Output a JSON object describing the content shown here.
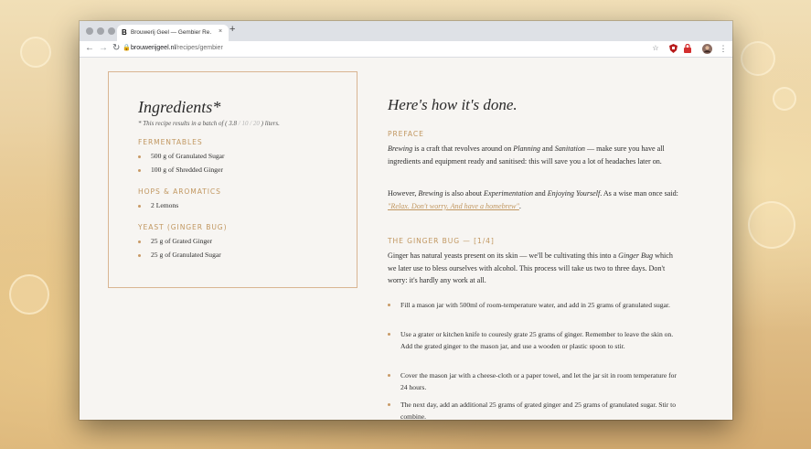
{
  "browser": {
    "tab_favicon": "B",
    "tab_title": "Brouwerij Geel — Gembier Re…",
    "tab_close": "×",
    "new_tab": "+",
    "url_host": "brouwerijgeel.nl",
    "url_path": "/recipes/gembier",
    "icons": [
      "back-icon",
      "forward-icon",
      "reload-icon",
      "lock-icon",
      "star-icon",
      "shield-extension-icon",
      "lock-extension-icon",
      "profile-avatar-icon",
      "menu-icon"
    ]
  },
  "ingredients": {
    "title": "Ingredients*",
    "batch_prefix": "* This recipe results in a batch of (",
    "batch_options": [
      "3.8",
      "10",
      "20"
    ],
    "batch_active": "3.8",
    "batch_suffix": ") liters.",
    "sections": [
      {
        "name": "FERMENTABLES",
        "items": [
          "500 g of Granulated Sugar",
          "100 g of Shredded Ginger"
        ]
      },
      {
        "name": "HOPS & AROMATICS",
        "items": [
          "2 Lemons"
        ]
      },
      {
        "name": "YEAST (GINGER BUG)",
        "items": [
          "25 g of Grated Ginger",
          "25 g of Granulated Sugar"
        ]
      }
    ]
  },
  "howto": {
    "title": "Here's how it's done.",
    "preface_heading": "PREFACE",
    "preface_p1": {
      "t1": "Brewing",
      "t2": " is a craft that revolves around on ",
      "t3": "Planning",
      "t4": " and ",
      "t5": "Sanitation",
      "t6": " — make sure you have all ingredients and equipment ready and sanitised: this will save you a lot of headaches later on."
    },
    "preface_p2": {
      "t1": "However, ",
      "t2": "Brewing",
      "t3": " is also about ",
      "t4": "Experimentation",
      "t5": " and ",
      "t6": "Enjoying Yourself",
      "t7": ". As a wise man once said: ",
      "quote": "\"Relax. Don't worry. And have a homebrew\"",
      "t8": "."
    },
    "ginger_heading": "THE GINGER BUG — [1/4]",
    "ginger_p": {
      "t1": "Ginger has natural yeasts present on its skin — we'll be cultivating this into a ",
      "t2": "Ginger Bug",
      "t3": " which we later use to bless ourselves with alcohol. This process will take us two to three days. Don't worry: it's hardly any work at all."
    },
    "steps": [
      "Fill a mason jar with 500ml of room-temperature water, and add in 25 grams of granulated sugar.",
      "Use a grater or kitchen knife to couresly grate 25 grams of ginger. Remember to leave the skin on. Add the grated ginger to the mason jar, and use a wooden or plastic spoon to stir.",
      "Cover the mason jar with a cheese-cloth or a paper towel, and let the jar sit in room temperature for 24 hours.",
      "The next day, add an additional 25 grams of grated ginger and 25 grams of granulated sugar. Stir to combine."
    ]
  }
}
